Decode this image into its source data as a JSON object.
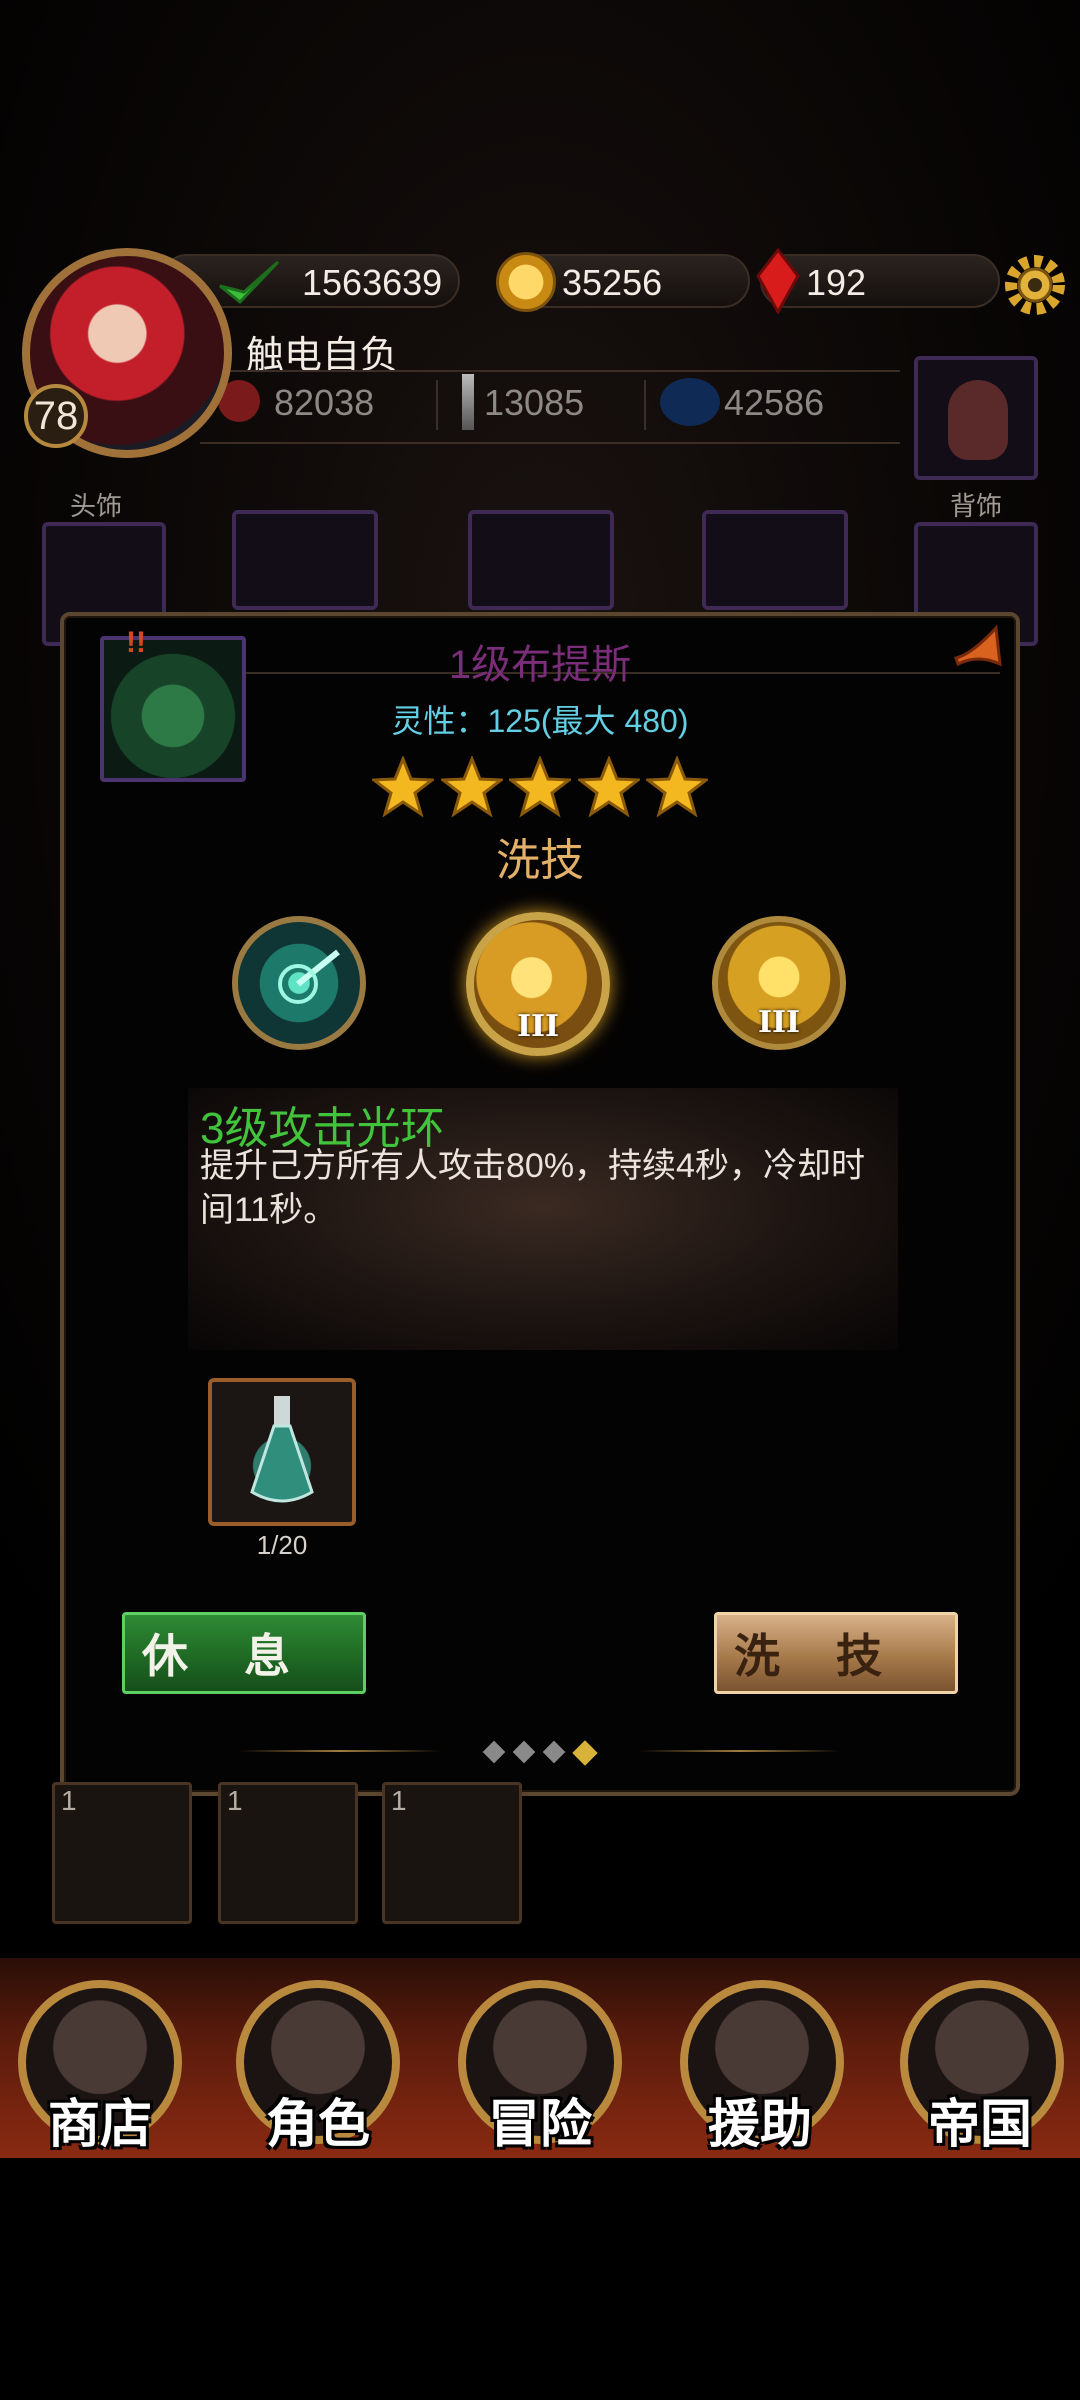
{
  "header": {
    "resources": {
      "energy": "1563639",
      "coins": "35256",
      "gems": "192"
    },
    "player": {
      "name": "触电自负",
      "level": "78"
    },
    "stats": {
      "health": "82038",
      "attack": "13085",
      "mana": "42586"
    },
    "slots": {
      "head_label": "头饰",
      "back_label": "背饰"
    }
  },
  "modal": {
    "title": "1级布提斯",
    "alert_mark": "!!",
    "spirit": "灵性：125(最大 480)",
    "stars": 5,
    "section_label": "洗技",
    "skills": [
      {
        "name": "skill-radar",
        "tier": ""
      },
      {
        "name": "skill-attack-aura",
        "tier": "III"
      },
      {
        "name": "skill-shield",
        "tier": "III"
      }
    ],
    "selected_skill": {
      "title": "3级攻击光环",
      "description": "提升己方所有人攻击80%，持续4秒，冷却时间11秒。"
    },
    "item": {
      "count": "1/20"
    },
    "buttons": {
      "rest": "休息",
      "wash": "洗技"
    },
    "pager": {
      "total": 4,
      "active": 4
    }
  },
  "roster": {
    "counts": [
      "1",
      "1",
      "1"
    ]
  },
  "nav": {
    "items": [
      {
        "label": "商店"
      },
      {
        "label": "角色"
      },
      {
        "label": "冒险"
      },
      {
        "label": "援助"
      },
      {
        "label": "帝国"
      }
    ]
  },
  "colors": {
    "title_purple": "#7a2d78",
    "spirit_cyan": "#63cfe3",
    "skill_green": "#41c43c",
    "accent_gold": "#e3b06a"
  }
}
